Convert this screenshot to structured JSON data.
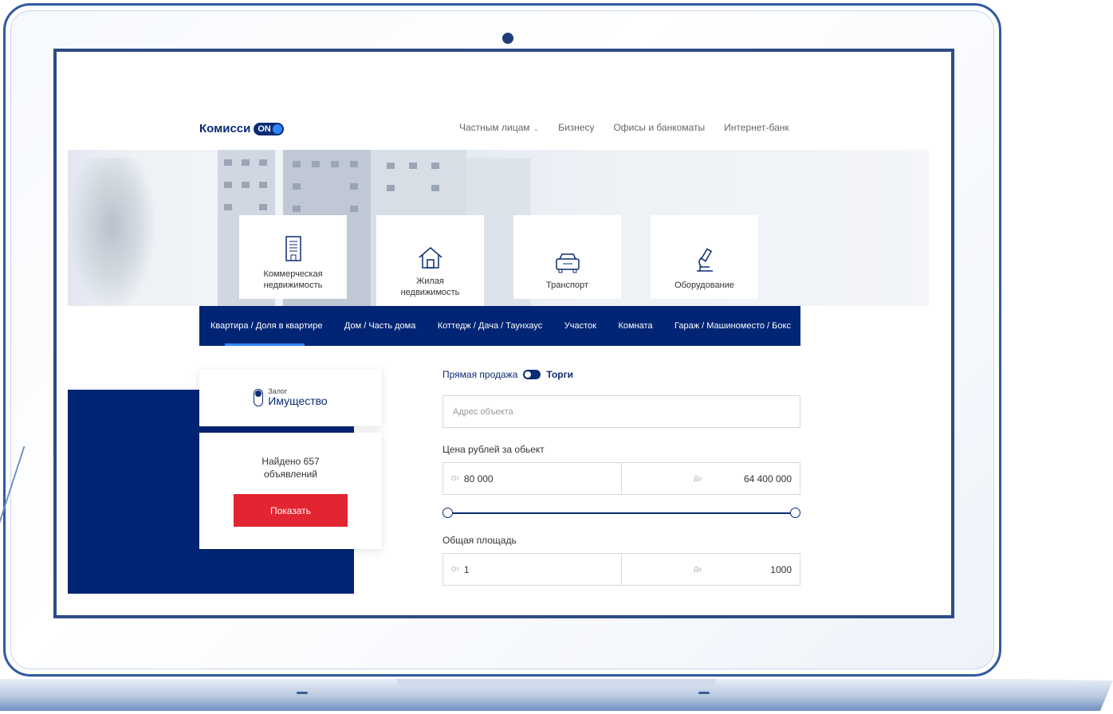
{
  "logo": {
    "text": "Комисси",
    "toggle": "ON"
  },
  "topnav": {
    "items": [
      "Частным лицам",
      "Бизнесу",
      "Офисы и банкоматы",
      "Интернет-банк"
    ]
  },
  "categories": [
    {
      "line1": "Коммерческая",
      "line2": "недвижимость",
      "icon": "building-icon"
    },
    {
      "line1": "Жилая",
      "line2": "недвижимость",
      "icon": "house-icon",
      "active": true
    },
    {
      "line1": "Транспорт",
      "line2": "",
      "icon": "car-icon"
    },
    {
      "line1": "Оборудование",
      "line2": "",
      "icon": "microscope-icon"
    }
  ],
  "subnav": {
    "items": [
      "Квартира / Доля в квартире",
      "Дом / Часть дома",
      "Коттедж / Дача / Таунхаус",
      "Участок",
      "Комната",
      "Гараж / Машиноместо / Бокс"
    ],
    "active_index": 0
  },
  "collateral": {
    "small": "Залог",
    "big": "Имущество"
  },
  "results": {
    "text": "Найдено 657 объявлений",
    "button": "Показать"
  },
  "sale": {
    "direct": "Прямая продажа",
    "auction": "Торги"
  },
  "address": {
    "placeholder": "Адрес объекта"
  },
  "price": {
    "label": "Цена рублей за обьект",
    "from_prefix": "От",
    "from": "80 000",
    "to_prefix": "До",
    "to": "64 400 000",
    "slider_low": 0,
    "slider_high": 1
  },
  "area": {
    "label": "Общая площадь",
    "from_prefix": "От",
    "from": "1",
    "to_prefix": "До",
    "to": "1000"
  },
  "colors": {
    "brand_blue": "#002575",
    "accent_red": "#e22531",
    "accent_light_blue": "#2f86ff"
  }
}
